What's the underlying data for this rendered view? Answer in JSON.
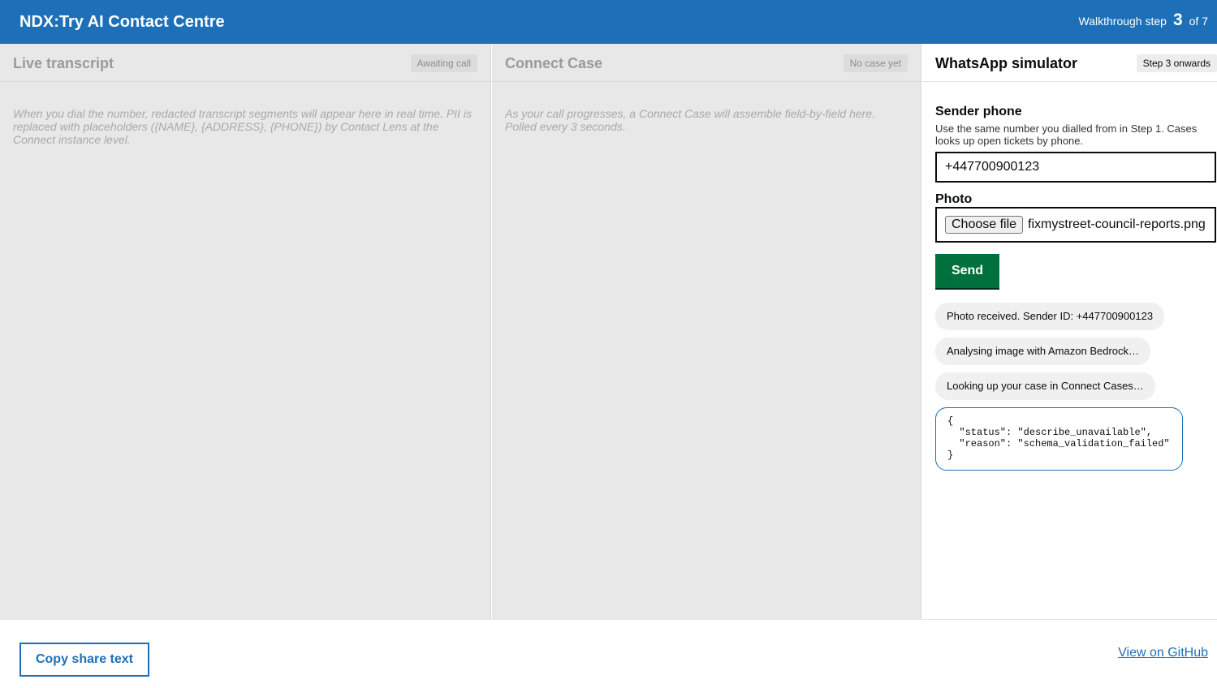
{
  "header": {
    "title": "NDX:Try AI Contact Centre",
    "step_label": "Walkthrough step",
    "step_number": "3",
    "step_total": "of 7"
  },
  "transcript": {
    "title": "Live transcript",
    "badge": "Awaiting call",
    "placeholder": "When you dial the number, redacted transcript segments will appear here in real time. PII is replaced with placeholders ({NAME}, {ADDRESS}, {PHONE}) by Contact Lens at the Connect instance level."
  },
  "case": {
    "title": "Connect Case",
    "badge": "No case yet",
    "placeholder": "As your call progresses, a Connect Case will assemble field-by-field here. Polled every 3 seconds."
  },
  "whatsapp": {
    "title": "WhatsApp simulator",
    "badge": "Step 3 onwards",
    "sender_label": "Sender phone",
    "sender_hint": "Use the same number you dialled from in Step 1. Cases looks up open tickets by phone.",
    "sender_value": "+447700900123",
    "photo_label": "Photo",
    "choose_file_label": "Choose file",
    "file_name": "fixmystreet-council-reports.png",
    "send_label": "Send",
    "messages": [
      "Photo received. Sender ID: +447700900123",
      "Analysing image with Amazon Bedrock…",
      "Looking up your case in Connect Cases…"
    ],
    "json_response": "{\n  \"status\": \"describe_unavailable\",\n  \"reason\": \"schema_validation_failed\"\n}"
  },
  "footer": {
    "copy_label": "Copy share text",
    "github_label": "View on GitHub"
  },
  "colors": {
    "brand_blue": "#1d70b8",
    "send_green": "#00703c",
    "panel_dim": "#e8e8e8"
  }
}
